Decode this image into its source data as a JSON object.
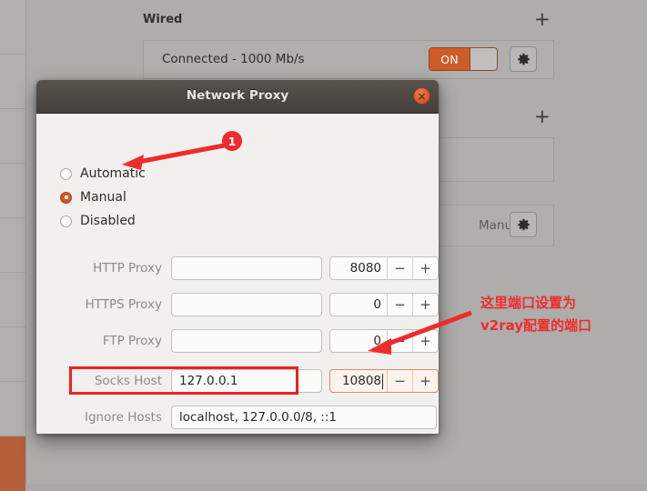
{
  "background": {
    "section_title": "Wired",
    "add_button_label": "+",
    "wired_status": "Connected - 1000 Mb/s",
    "toggle_label": "ON",
    "gear_icon": "gear-icon",
    "proxy_mode_value": "Manual",
    "second_add_button_label": "+"
  },
  "dialog": {
    "title": "Network Proxy",
    "close_icon": "×",
    "modes": [
      {
        "label": "Automatic",
        "checked": false
      },
      {
        "label": "Manual",
        "checked": true
      },
      {
        "label": "Disabled",
        "checked": false
      }
    ],
    "fields": [
      {
        "label": "HTTP Proxy",
        "host": "",
        "port": "8080",
        "focused": false
      },
      {
        "label": "HTTPS Proxy",
        "host": "",
        "port": "0",
        "focused": false
      },
      {
        "label": "FTP Proxy",
        "host": "",
        "port": "0",
        "focused": false
      },
      {
        "label": "Socks Host",
        "host": "127.0.0.1",
        "port": "10808",
        "focused": true
      }
    ],
    "ignore_hosts": {
      "label": "Ignore Hosts",
      "value": "localhost, 127.0.0.0/8, ::1"
    },
    "spinner_minus": "−",
    "spinner_plus": "+"
  },
  "annotations": {
    "badge_one": "1",
    "note_line1": "这里端口设置为",
    "note_line2": "v2ray配置的端口"
  },
  "colors": {
    "accent_orange": "#cd5c28",
    "annotation_red": "#f02b2b",
    "highlight_red": "#f02020",
    "dialog_bg": "#f1f0ee",
    "titlebar": "#4b4641"
  }
}
